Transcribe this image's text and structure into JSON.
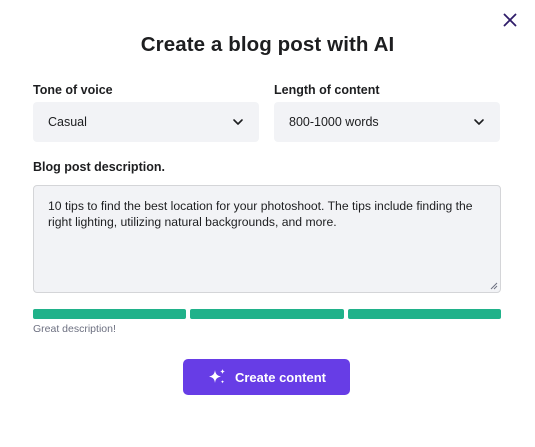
{
  "modal": {
    "title": "Create a blog post with AI"
  },
  "tone": {
    "label": "Tone of voice",
    "value": "Casual"
  },
  "length": {
    "label": "Length of content",
    "value": "800-1000 words"
  },
  "description": {
    "label": "Blog post description.",
    "text": "10 tips to find the best location for your photoshoot. The tips include finding the right lighting, utilizing natural backgrounds, and more."
  },
  "quality": {
    "segments_filled": 3,
    "segments_total": 3,
    "hint": "Great description!",
    "color": "#20b28a"
  },
  "actions": {
    "create_label": "Create content",
    "create_icon": "sparkles-icon",
    "accent": "#673de6"
  },
  "icons": {
    "close": "close-icon",
    "dropdown": "chevron-down-icon"
  }
}
